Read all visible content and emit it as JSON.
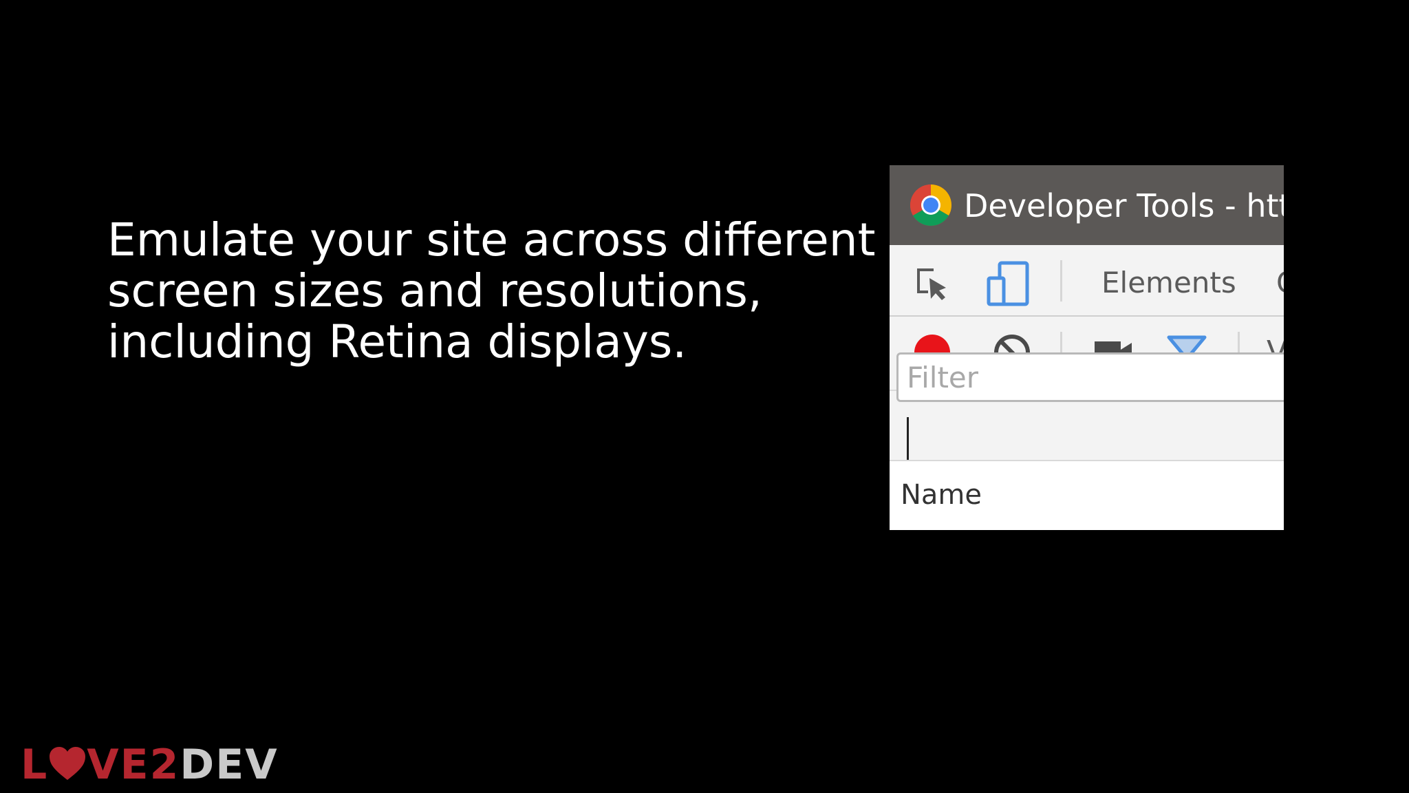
{
  "slide": {
    "headline_lines": [
      "Emulate your site across different",
      "screen sizes and resolutions,",
      "including Retina displays."
    ]
  },
  "devtools": {
    "window_title": "Developer Tools - http",
    "tabs": {
      "elements_label": "Elements",
      "next_tab_partial": "C"
    },
    "network_toolbar": {
      "partial_label": "V"
    },
    "filter": {
      "placeholder": "Filter",
      "value": ""
    },
    "table": {
      "name_header": "Name"
    },
    "icons": {
      "inspect": "inspect-element-icon",
      "device": "device-toolbar-icon",
      "record": "record-icon",
      "clear": "clear-icon",
      "screenshots": "camera-icon",
      "filter": "filter-icon"
    },
    "colors": {
      "record": "#e8141a",
      "active_blue": "#4a90e2",
      "titlebar": "#5b5856"
    }
  },
  "logo": {
    "part1": "L",
    "part2": "VE2",
    "part3": "DEV",
    "colors": {
      "red": "#b5262f",
      "grey": "#c9c9c9"
    }
  }
}
